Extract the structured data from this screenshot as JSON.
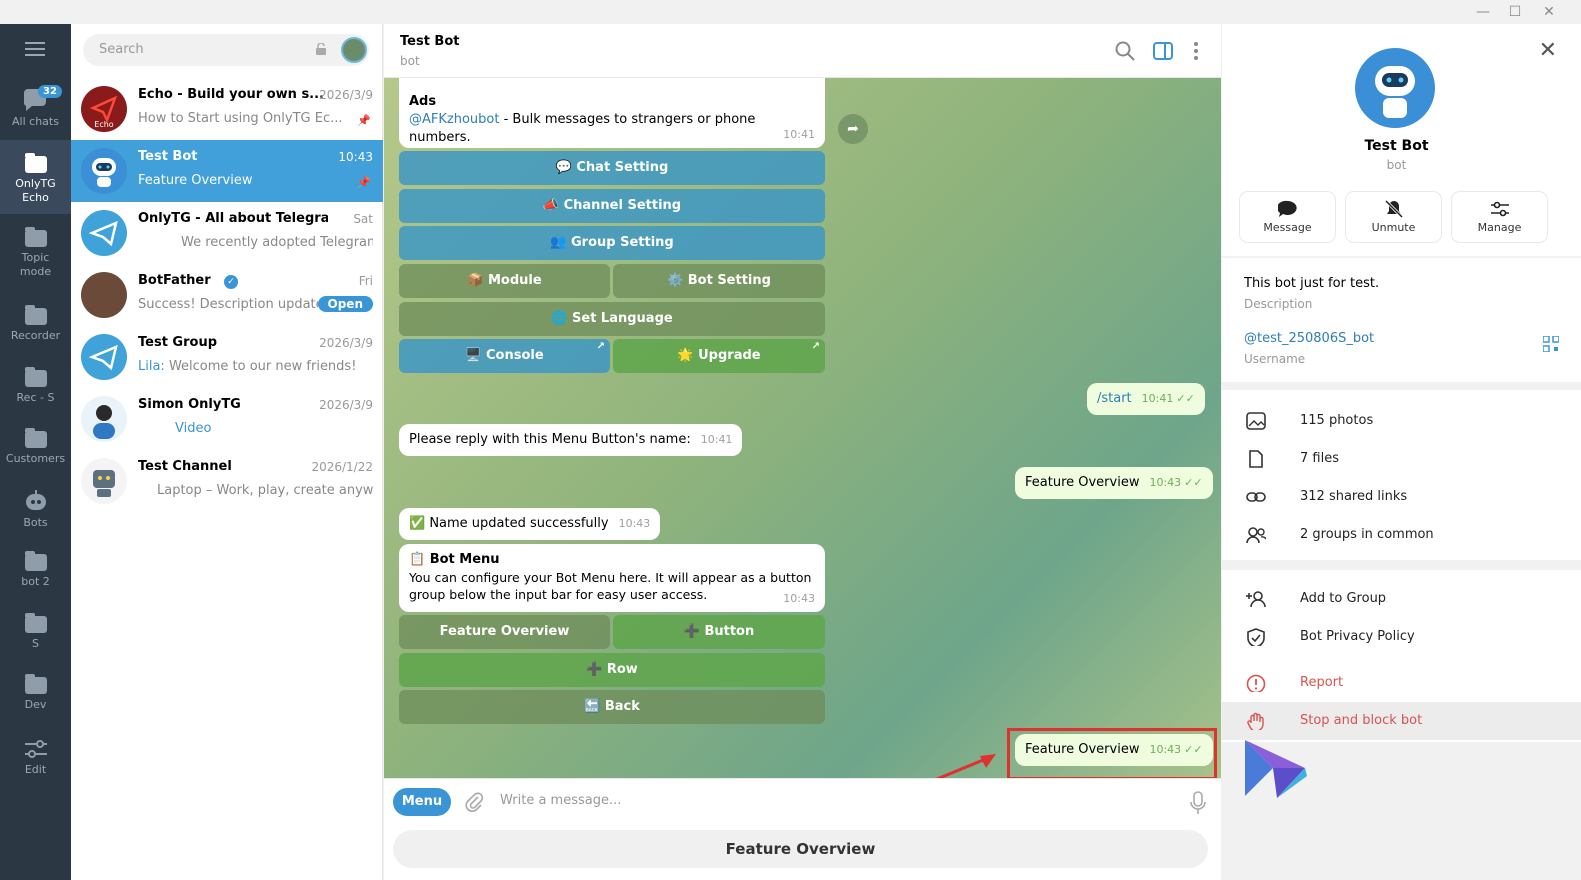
{
  "window": {
    "controls": [
      "—",
      "☐",
      "✕"
    ]
  },
  "rail": {
    "all_chats_label": "All chats",
    "unread_count": "32",
    "folders": [
      {
        "label": "OnlyTG\nEcho",
        "l1": "OnlyTG",
        "l2": "Echo"
      },
      {
        "l1": "Topic",
        "l2": "mode"
      },
      {
        "l1": "Recorder",
        "l2": ""
      },
      {
        "l1": "Rec - S",
        "l2": ""
      },
      {
        "l1": "Customers",
        "l2": ""
      },
      {
        "l1": "Bots",
        "l2": ""
      },
      {
        "l1": "bot 2",
        "l2": ""
      },
      {
        "l1": "S",
        "l2": ""
      },
      {
        "l1": "Dev",
        "l2": ""
      },
      {
        "l1": "Edit",
        "l2": ""
      }
    ]
  },
  "chatlist": {
    "search_placeholder": "Search",
    "chats": [
      {
        "name": "Echo - Build your own s...",
        "date": "2026/3/9",
        "preview": "How to Start using OnlyTG Ec...",
        "avatar_text": "Echo"
      },
      {
        "name": "Test Bot",
        "date": "10:43",
        "preview": "Feature Overview"
      },
      {
        "name": "OnlyTG - All about Telegram",
        "date": "Sat",
        "preview": "We recently adopted Telegram..."
      },
      {
        "name": "BotFather",
        "date": "Fri",
        "preview": "Success! Description updated...",
        "action": "Open"
      },
      {
        "name": "Test Group",
        "date": "2026/3/9",
        "preview_sender": "Lila:",
        "preview": "Welcome to our new friends!"
      },
      {
        "name": "Simon OnlyTG",
        "date": "2026/3/9",
        "preview": "Video"
      },
      {
        "name": "Test Channel",
        "date": "2026/1/22",
        "preview": "Laptop – Work, play, create anywh..."
      }
    ]
  },
  "chat": {
    "title": "Test Bot",
    "subtitle": "bot",
    "ads_title": "Ads",
    "ads_link": "@AFKzhoubot",
    "ads_text": " - Bulk messages to strangers or phone numbers.",
    "ads_time": "10:41",
    "kb1": {
      "chat_setting": "💬 Chat Setting",
      "channel_setting": "📣 Channel Setting",
      "group_setting": "👥 Group Setting",
      "module": "📦 Module",
      "bot_setting": "⚙️ Bot Setting",
      "set_language": "🌐 Set Language",
      "console": "🖥️ Console",
      "upgrade": "🌟 Upgrade"
    },
    "msg_start": "/start",
    "msg_start_time": "10:41",
    "msg_reply_prompt": "Please reply with this Menu Button's name:",
    "msg_reply_prompt_time": "10:41",
    "msg_feature_out": "Feature Overview",
    "msg_feature_out_time": "10:43",
    "msg_updated": "✅ Name updated successfully",
    "msg_updated_time": "10:43",
    "bot_menu_title": "📋 Bot Menu",
    "bot_menu_text": "You can configure your Bot Menu here. It will appear as a button group below the input bar for easy user access.",
    "bot_menu_time": "10:43",
    "kb2": {
      "feature_overview": "Feature Overview",
      "button": "➕ Button",
      "row": "➕ Row",
      "back": "🔙 Back"
    },
    "msg_last": "Feature Overview",
    "msg_last_time": "10:43",
    "menu_label": "Menu",
    "input_placeholder": "Write a message...",
    "reply_keyboard": "Feature Overview"
  },
  "profile": {
    "name": "Test Bot",
    "sub": "bot",
    "buttons": {
      "message": "Message",
      "unmute": "Unmute",
      "manage": "Manage"
    },
    "description": "This bot just for test.",
    "description_label": "Description",
    "username": "@test_250806S_bot",
    "username_label": "Username",
    "media": {
      "photos": "115 photos",
      "files": "7 files",
      "links": "312 shared links",
      "groups": "2 groups in common"
    },
    "actions": {
      "add_group": "Add to Group",
      "privacy": "Bot Privacy Policy",
      "report": "Report",
      "stop": "Stop and block bot"
    }
  },
  "colors": {
    "accent": "#419fd9",
    "danger": "#d9534f",
    "rail": "#2c3744",
    "highlight": "#e03030"
  }
}
